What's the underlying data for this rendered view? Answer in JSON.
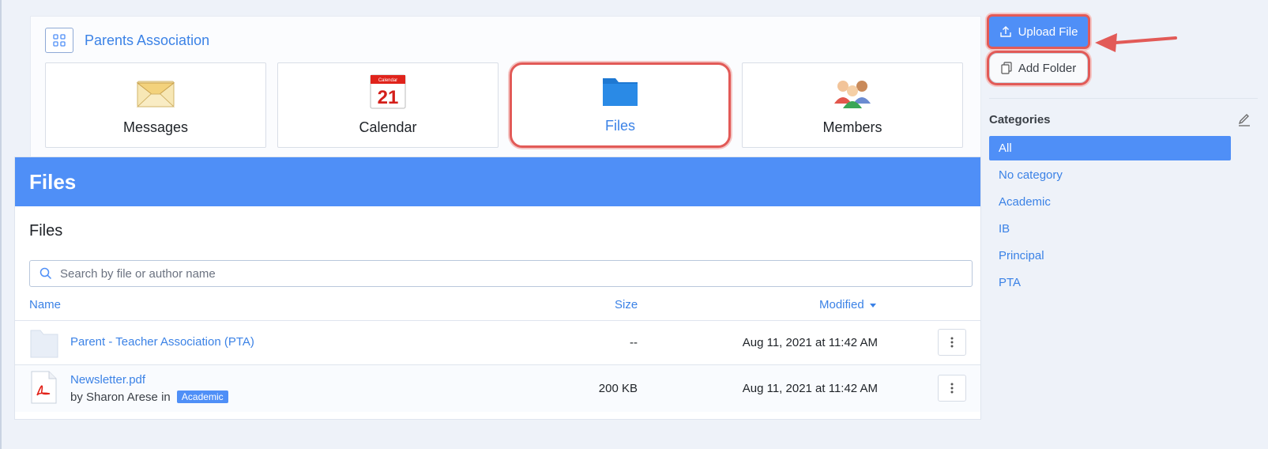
{
  "group": {
    "name": "Parents Association",
    "tiles": [
      {
        "label": "Messages",
        "icon": "envelope-icon"
      },
      {
        "label": "Calendar",
        "icon": "calendar-icon",
        "day": "21",
        "header": "Calendar"
      },
      {
        "label": "Files",
        "icon": "folder-icon",
        "active": true
      },
      {
        "label": "Members",
        "icon": "members-icon"
      }
    ]
  },
  "files": {
    "banner_title": "Files",
    "subtitle": "Files",
    "search_placeholder": "Search by file or author name",
    "columns": {
      "name": "Name",
      "size": "Size",
      "modified": "Modified"
    },
    "rows": [
      {
        "name": "Parent - Teacher Association (PTA)",
        "type": "folder",
        "size": "--",
        "modified": "Aug 11, 2021 at 11:42 AM"
      },
      {
        "name": "Newsletter.pdf",
        "type": "pdf",
        "byline_prefix": "by Sharon Arese in",
        "category": "Academic",
        "size": "200 KB",
        "modified": "Aug 11, 2021 at 11:42 AM"
      }
    ]
  },
  "sidebar": {
    "upload_label": "Upload File",
    "add_folder_label": "Add Folder",
    "categories_title": "Categories",
    "categories": [
      {
        "label": "All",
        "active": true
      },
      {
        "label": "No category"
      },
      {
        "label": "Academic"
      },
      {
        "label": "IB"
      },
      {
        "label": "Principal"
      },
      {
        "label": "PTA"
      }
    ]
  },
  "colors": {
    "accent": "#4f8ff7",
    "link": "#3b82e6",
    "highlight": "#e25a57"
  }
}
